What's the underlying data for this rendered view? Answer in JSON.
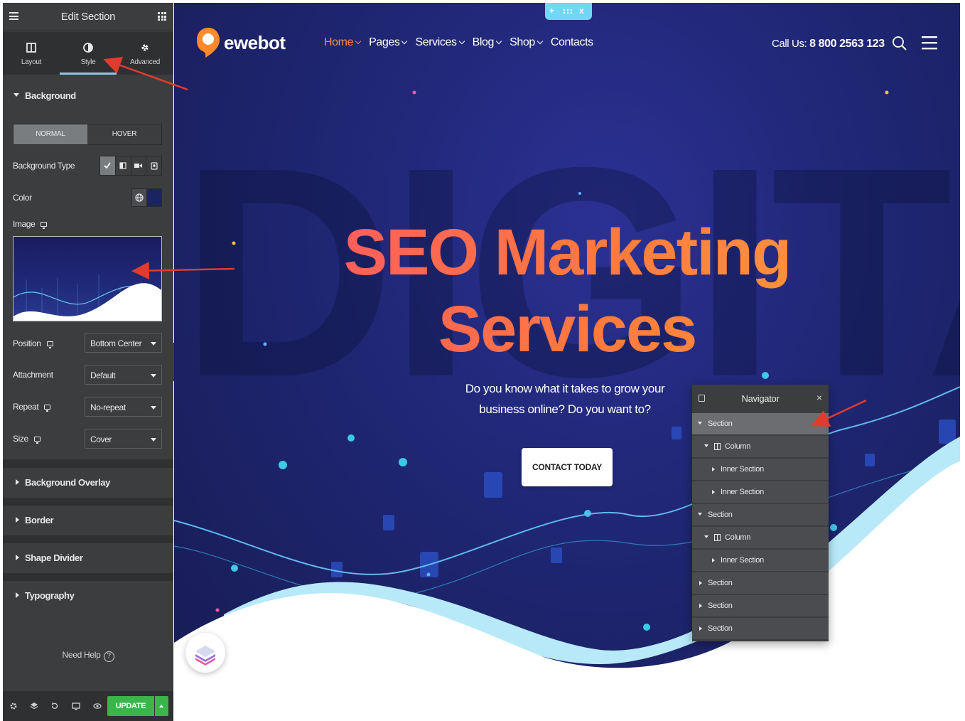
{
  "panel": {
    "title": "Edit Section",
    "tabs": [
      {
        "label": "Layout",
        "icon": "layout-icon",
        "active": false
      },
      {
        "label": "Style",
        "icon": "style-icon",
        "active": true
      },
      {
        "label": "Advanced",
        "icon": "gear-icon",
        "active": false
      }
    ],
    "background": {
      "section_label": "Background",
      "state_tabs": [
        "NORMAL",
        "HOVER"
      ],
      "active_state": "NORMAL",
      "type_label": "Background Type",
      "color_label": "Color",
      "color_value": "#1a2560",
      "image_label": "Image",
      "position_label": "Position",
      "position_value": "Bottom Center",
      "attachment_label": "Attachment",
      "attachment_value": "Default",
      "repeat_label": "Repeat",
      "repeat_value": "No-repeat",
      "size_label": "Size",
      "size_value": "Cover"
    },
    "collapsed_sections": [
      "Background Overlay",
      "Border",
      "Shape Divider",
      "Typography"
    ],
    "help_label": "Need Help",
    "help_icon": "?",
    "update_label": "UPDATE",
    "accent": "#39b54a"
  },
  "site": {
    "logo_text": "ewebot",
    "nav": [
      {
        "label": "Home",
        "dropdown": true,
        "active": true
      },
      {
        "label": "Pages",
        "dropdown": true,
        "active": false
      },
      {
        "label": "Services",
        "dropdown": true,
        "active": false
      },
      {
        "label": "Blog",
        "dropdown": true,
        "active": false
      },
      {
        "label": "Shop",
        "dropdown": true,
        "active": false
      },
      {
        "label": "Contacts",
        "dropdown": false,
        "active": false
      }
    ],
    "call_label": "Call Us:",
    "call_number": "8 800 2563 123",
    "watermark": "DIGITAL",
    "hero_line1": "SEO Marketing",
    "hero_line2": "Services",
    "hero_sub1": "Do you know what it takes to grow your",
    "hero_sub2": "business online? Do you want to?",
    "cta_label": "CONTACT TODAY",
    "handle_plus": "+",
    "handle_close": "x",
    "hero_gradient": [
      "#ff4d6d",
      "#ffa23d"
    ]
  },
  "navigator": {
    "title": "Navigator",
    "close": "×",
    "rows": [
      {
        "label": "Section",
        "indent": 0,
        "expanded": true,
        "selected": true,
        "column_icon": false
      },
      {
        "label": "Column",
        "indent": 1,
        "expanded": true,
        "selected": false,
        "column_icon": true
      },
      {
        "label": "Inner Section",
        "indent": 2,
        "expanded": false,
        "selected": false,
        "column_icon": false
      },
      {
        "label": "Inner Section",
        "indent": 2,
        "expanded": false,
        "selected": false,
        "column_icon": false
      },
      {
        "label": "Section",
        "indent": 0,
        "expanded": true,
        "selected": false,
        "column_icon": false
      },
      {
        "label": "Column",
        "indent": 1,
        "expanded": true,
        "selected": false,
        "column_icon": true
      },
      {
        "label": "Inner Section",
        "indent": 2,
        "expanded": false,
        "selected": false,
        "column_icon": false
      },
      {
        "label": "Section",
        "indent": 0,
        "expanded": false,
        "selected": false,
        "column_icon": false
      },
      {
        "label": "Section",
        "indent": 0,
        "expanded": false,
        "selected": false,
        "column_icon": false
      },
      {
        "label": "Section",
        "indent": 0,
        "expanded": false,
        "selected": false,
        "column_icon": false
      }
    ]
  }
}
